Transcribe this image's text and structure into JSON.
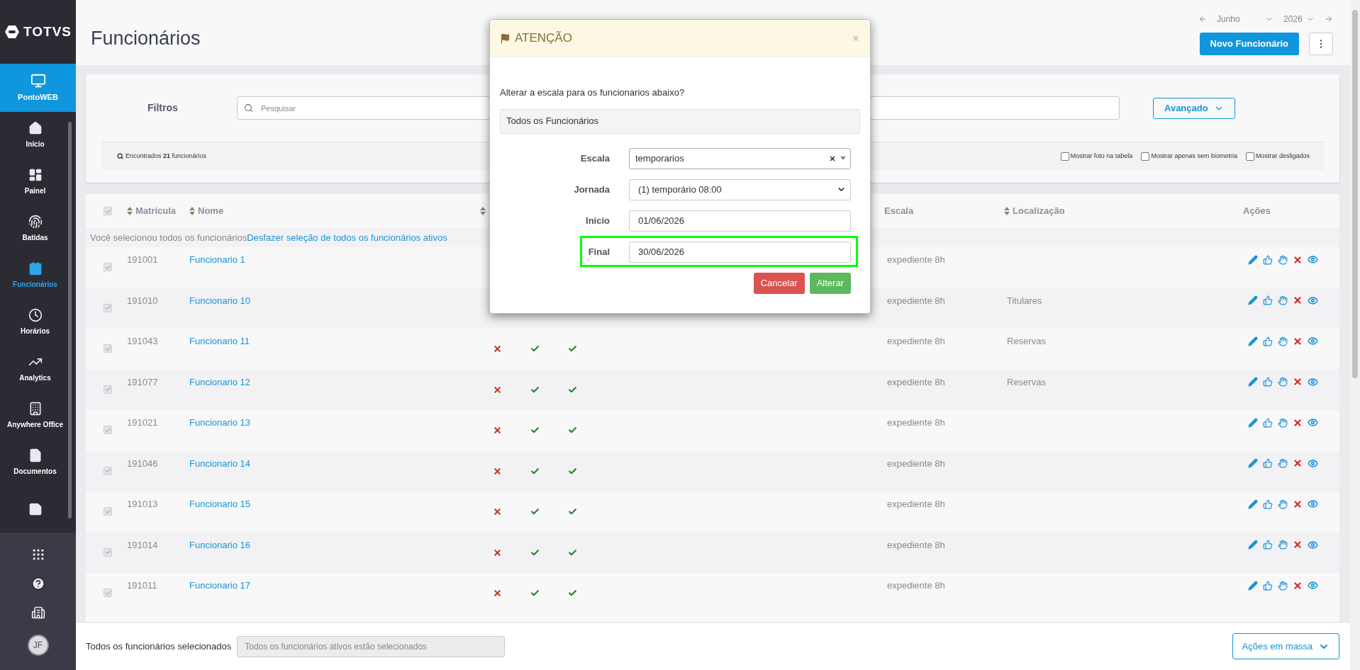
{
  "sidebar": {
    "logo": "TOTVS",
    "module": {
      "label": "PontoWEB",
      "selected": true
    },
    "items": [
      {
        "label": "Início",
        "selected": false
      },
      {
        "label": "Painel",
        "selected": false
      },
      {
        "label": "Batidas",
        "selected": false
      },
      {
        "label": "Funcionários",
        "selected": true
      },
      {
        "label": "Horários",
        "selected": false
      },
      {
        "label": "Analytics",
        "selected": false
      },
      {
        "label": "Anywhere Office",
        "selected": false
      },
      {
        "label": "Documentos",
        "selected": false
      },
      {
        "selected": false
      }
    ],
    "avatar": "JF"
  },
  "header": {
    "title": "Funcionários",
    "month": "Junho",
    "year": "2026",
    "new_button": "Novo Funcionário"
  },
  "filters": {
    "label": "Filtros",
    "search_placeholder": "Pesquisar",
    "advanced_button": "Avançado",
    "found": "Encontrados **21** funcionários",
    "options": [
      {
        "label": "Mostrar foto na tabela",
        "checked": false
      },
      {
        "label": "Mostrar apenas sem biometria",
        "checked": false
      },
      {
        "label": "Mostrar desligados",
        "checked": false
      }
    ]
  },
  "table": {
    "select_all_checked": true,
    "columns": [
      {
        "label": "Matrícula",
        "sortable": true
      },
      {
        "label": "Nome",
        "sortable": true
      },
      {
        "sortable": true
      },
      {
        "label": "Escala",
        "sortable": false
      },
      {
        "label": "Localização",
        "sortable": true
      },
      {
        "label": "Ações",
        "sortable": false
      }
    ],
    "notice": {
      "text": "Você selecionou todos os funcionários",
      "link": "Desfazer seleção de todos os funcionários ativos"
    },
    "rows": [
      {
        "checked": true,
        "id": "191001",
        "name": "Funcionario 1",
        "flags": [],
        "escala": "expediente 8h"
      },
      {
        "checked": true,
        "id": "191010",
        "name": "Funcionario 10",
        "flags": [],
        "escala": "expediente 8h",
        "location": "Titulares"
      },
      {
        "checked": true,
        "id": "191043",
        "name": "Funcionario 11",
        "flags": [
          false,
          true,
          true
        ],
        "escala": "expediente 8h",
        "location": "Reservas"
      },
      {
        "checked": true,
        "id": "191077",
        "name": "Funcionario 12",
        "flags": [
          false,
          true,
          true
        ],
        "escala": "expediente 8h",
        "location": "Reservas"
      },
      {
        "checked": true,
        "id": "191021",
        "name": "Funcionario 13",
        "flags": [
          false,
          true,
          true
        ],
        "escala": "expediente 8h"
      },
      {
        "checked": true,
        "id": "191046",
        "name": "Funcionario 14",
        "flags": [
          false,
          true,
          true
        ],
        "escala": "expediente 8h"
      },
      {
        "checked": true,
        "id": "191013",
        "name": "Funcionario 15",
        "flags": [
          false,
          true,
          true
        ],
        "escala": "expediente 8h"
      },
      {
        "checked": true,
        "id": "191014",
        "name": "Funcionario 16",
        "flags": [
          false,
          true,
          true
        ],
        "escala": "expediente 8h"
      },
      {
        "checked": true,
        "id": "191011",
        "name": "Funcionario 17",
        "flags": [
          false,
          true,
          true
        ],
        "escala": "expediente 8h"
      }
    ]
  },
  "bottom_bar": {
    "label": "Todos os funcionários selecionados",
    "field_value": "Todos os funcionários ativos estão selecionados",
    "mass_button": "Ações em massa"
  },
  "modal": {
    "title": "ATENÇÃO",
    "question": "Alterar a escala para os funcionarios abaixo?",
    "selection": "Todos os Funcionários",
    "fields": [
      {
        "label": "Escala",
        "kind": "combo",
        "value": "temporarios",
        "highlighted": false
      },
      {
        "label": "Jornada",
        "kind": "select",
        "value": "(1) temporário 08:00",
        "highlighted": false
      },
      {
        "label": "Início",
        "kind": "input",
        "value": "01/06/2026",
        "highlighted": false
      },
      {
        "label": "Final",
        "kind": "input",
        "value": "30/06/2026",
        "highlighted": true
      }
    ],
    "cancel_button": "Cancelar",
    "confirm_button": "Alterar"
  }
}
